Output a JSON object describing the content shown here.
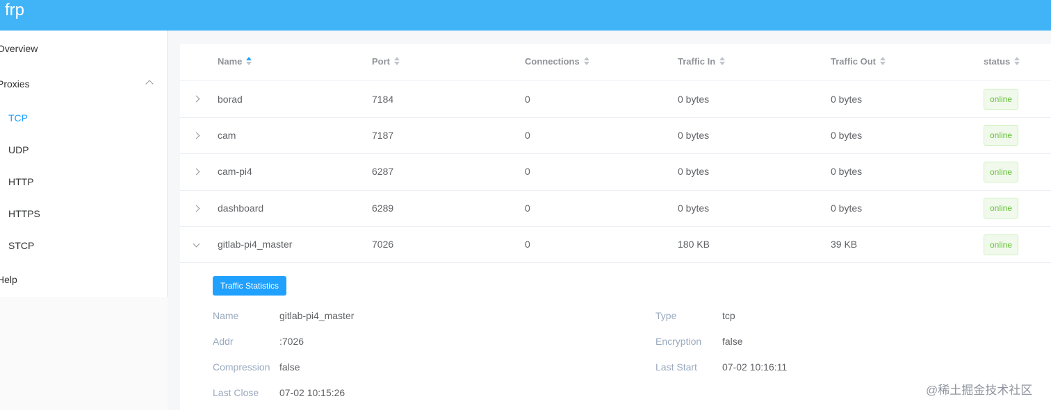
{
  "app": {
    "title": "frp"
  },
  "sidebar": {
    "overview": "Overview",
    "proxies": "Proxies",
    "sub_items": [
      "TCP",
      "UDP",
      "HTTP",
      "HTTPS",
      "STCP"
    ],
    "active": "TCP",
    "help": "Help"
  },
  "table": {
    "columns": [
      "Name",
      "Port",
      "Connections",
      "Traffic In",
      "Traffic Out",
      "status"
    ],
    "rows": [
      {
        "name": "borad",
        "port": "7184",
        "connections": "0",
        "traffic_in": "0 bytes",
        "traffic_out": "0 bytes",
        "status": "online"
      },
      {
        "name": "cam",
        "port": "7187",
        "connections": "0",
        "traffic_in": "0 bytes",
        "traffic_out": "0 bytes",
        "status": "online"
      },
      {
        "name": "cam-pi4",
        "port": "6287",
        "connections": "0",
        "traffic_in": "0 bytes",
        "traffic_out": "0 bytes",
        "status": "online"
      },
      {
        "name": "dashboard",
        "port": "6289",
        "connections": "0",
        "traffic_in": "0 bytes",
        "traffic_out": "0 bytes",
        "status": "online"
      },
      {
        "name": "gitlab-pi4_master",
        "port": "7026",
        "connections": "0",
        "traffic_in": "180 KB",
        "traffic_out": "39 KB",
        "status": "online"
      }
    ]
  },
  "details": {
    "button_label": "Traffic Statistics",
    "name_label": "Name",
    "name_value": "gitlab-pi4_master",
    "type_label": "Type",
    "type_value": "tcp",
    "addr_label": "Addr",
    "addr_value": ":7026",
    "encryption_label": "Encryption",
    "encryption_value": "false",
    "compression_label": "Compression",
    "compression_value": "false",
    "last_start_label": "Last Start",
    "last_start_value": "07-02 10:16:11",
    "last_close_label": "Last Close",
    "last_close_value": "07-02 10:15:26"
  },
  "watermark": "@稀土掘金技术社区",
  "colors": {
    "header": "#41b3f7",
    "accent": "#20a0ff",
    "online": "#67c23a"
  }
}
